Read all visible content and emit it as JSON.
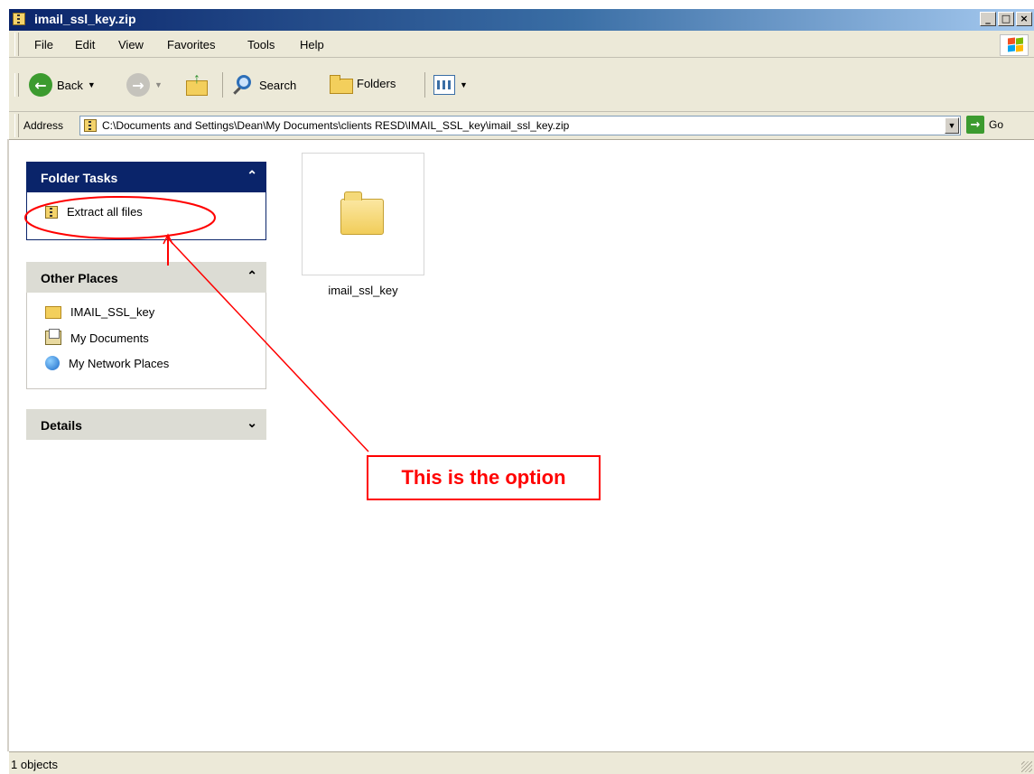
{
  "window": {
    "title": "imail_ssl_key.zip"
  },
  "menubar": {
    "items": [
      "File",
      "Edit",
      "View",
      "Favorites",
      "Tools",
      "Help"
    ]
  },
  "toolbar": {
    "back_label": "Back",
    "search_label": "Search",
    "folders_label": "Folders"
  },
  "address": {
    "label": "Address",
    "value": "C:\\Documents and Settings\\Dean\\My Documents\\clients RESD\\IMAIL_SSL_key\\imail_ssl_key.zip",
    "go_label": "Go"
  },
  "folder_tasks": {
    "title": "Folder Tasks",
    "items": [
      {
        "label": "Extract all files",
        "icon": "zip-folder-icon"
      }
    ]
  },
  "other_places": {
    "title": "Other Places",
    "items": [
      {
        "label": "IMAIL_SSL_key",
        "icon": "folder-icon"
      },
      {
        "label": "My Documents",
        "icon": "my-documents-icon"
      },
      {
        "label": "My Network Places",
        "icon": "network-places-icon"
      }
    ]
  },
  "details": {
    "title": "Details"
  },
  "content": {
    "items": [
      {
        "label": "imail_ssl_key",
        "icon": "folder-icon"
      }
    ]
  },
  "annotation": {
    "text": "This is the option",
    "color": "#ff0000"
  },
  "status_bar": {
    "text": "1 objects"
  },
  "colors": {
    "title_start": "#0a246a",
    "task_header_dark": "#0a246a",
    "task_header_light": "#dcdcd4",
    "chrome": "#ece9d8"
  }
}
